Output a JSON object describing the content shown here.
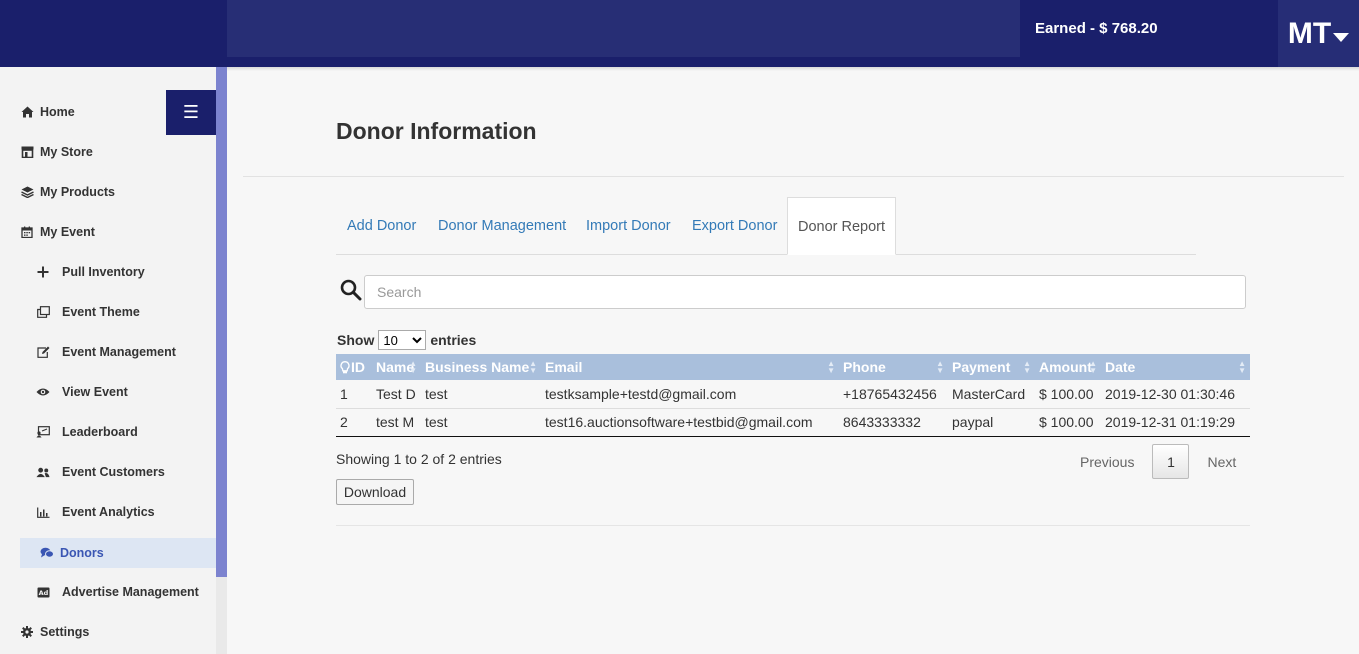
{
  "header": {
    "earned": "Earned - $ 768.20",
    "avatar_initials": "MT"
  },
  "sidebar": {
    "items": [
      {
        "label": "Home",
        "icon": "home-icon"
      },
      {
        "label": "My Store",
        "icon": "store-icon"
      },
      {
        "label": "My Products",
        "icon": "layers-icon"
      },
      {
        "label": "My Event",
        "icon": "calendar-icon"
      },
      {
        "label": "Pull Inventory",
        "icon": "plus-icon"
      },
      {
        "label": "Event Theme",
        "icon": "copy-icon"
      },
      {
        "label": "Event Management",
        "icon": "edit-icon"
      },
      {
        "label": "View Event",
        "icon": "eye-icon"
      },
      {
        "label": "Leaderboard",
        "icon": "leaderboard-icon"
      },
      {
        "label": "Event Customers",
        "icon": "users-icon"
      },
      {
        "label": "Event Analytics",
        "icon": "bar-chart-icon"
      },
      {
        "label": "Donors",
        "icon": "donors-icon"
      },
      {
        "label": "Advertise Management",
        "icon": "ad-icon"
      },
      {
        "label": "Settings",
        "icon": "gear-icon"
      }
    ]
  },
  "main": {
    "title": "Donor Information",
    "tabs": [
      "Add Donor",
      "Donor Management",
      "Import Donor",
      "Export Donor",
      "Donor Report"
    ],
    "search_placeholder": "Search",
    "show_label": "Show",
    "entries_label": "entries",
    "page_size": "10",
    "table": {
      "columns": [
        "ID",
        "Name",
        "Business Name",
        "Email",
        "Phone",
        "Payment",
        "Amount",
        "Date"
      ],
      "rows": [
        [
          "1",
          "Test D",
          "test",
          "testksample+testd@gmail.com",
          "+18765432456",
          "MasterCard",
          "$ 100.00",
          "2019-12-30 01:30:46"
        ],
        [
          "2",
          "test M",
          "test",
          "test16.auctionsoftware+testbid@gmail.com",
          "8643333332",
          "paypal",
          "$ 100.00",
          "2019-12-31 01:19:29"
        ]
      ]
    },
    "info": "Showing 1 to 2 of 2 entries",
    "pagination": {
      "previous": "Previous",
      "current": "1",
      "next": "Next"
    },
    "download_label": "Download"
  },
  "colors": {
    "header_bg": "#1a1f6b",
    "sidebar_accent": "#7c83cf",
    "table_header": "#a9bfdc",
    "link": "#337ab7"
  }
}
